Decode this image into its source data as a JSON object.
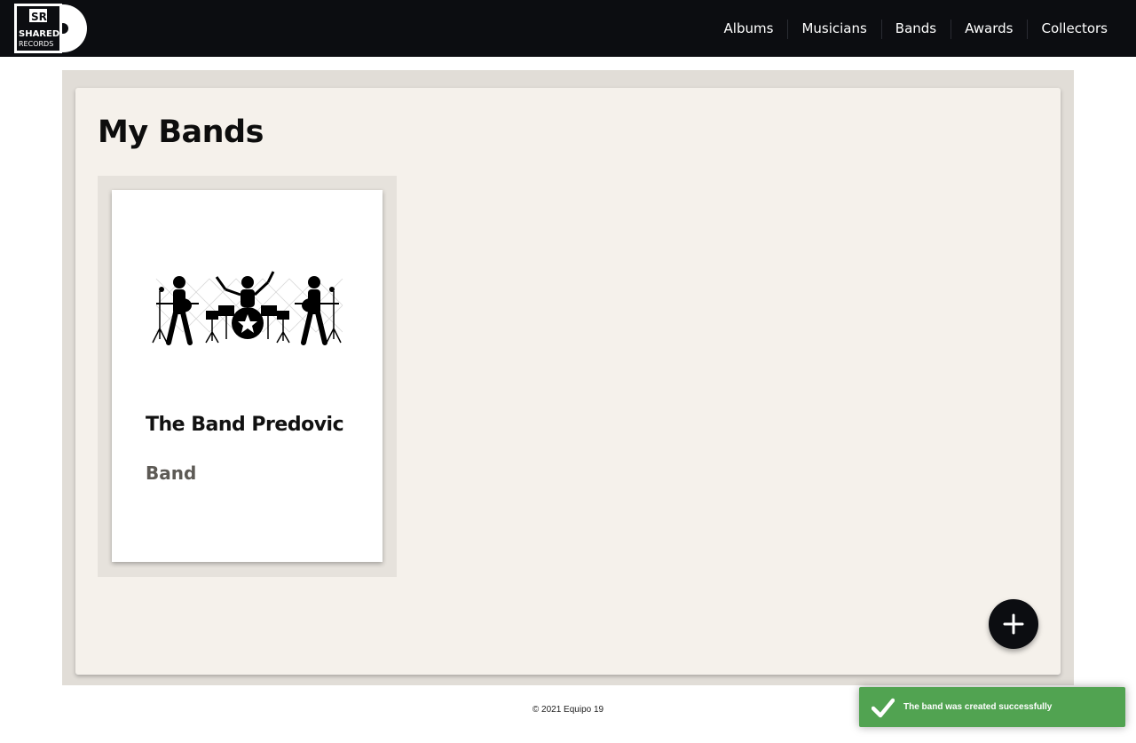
{
  "brand": {
    "logo_text_top": "SR",
    "logo_text_mid": "SHARED",
    "logo_text_bottom": "RECORDS"
  },
  "nav": {
    "items": [
      {
        "label": "Albums"
      },
      {
        "label": "Musicians"
      },
      {
        "label": "Bands"
      },
      {
        "label": "Awards"
      },
      {
        "label": "Collectors"
      }
    ]
  },
  "main": {
    "title": "My Bands",
    "cards": [
      {
        "name": "The Band Predovic",
        "type": "Band",
        "image_icon": "band-silhouette-icon"
      }
    ],
    "add_button_icon": "plus-icon"
  },
  "footer": {
    "copyright": "© 2021 Equipo 19"
  },
  "toast": {
    "message": "The band was created successfully",
    "icon": "checkmark-icon",
    "color": "#51a351"
  },
  "colors": {
    "navbar": "#0c0d11",
    "panel": "#f5f1eb",
    "outer": "#e1ddd7"
  }
}
